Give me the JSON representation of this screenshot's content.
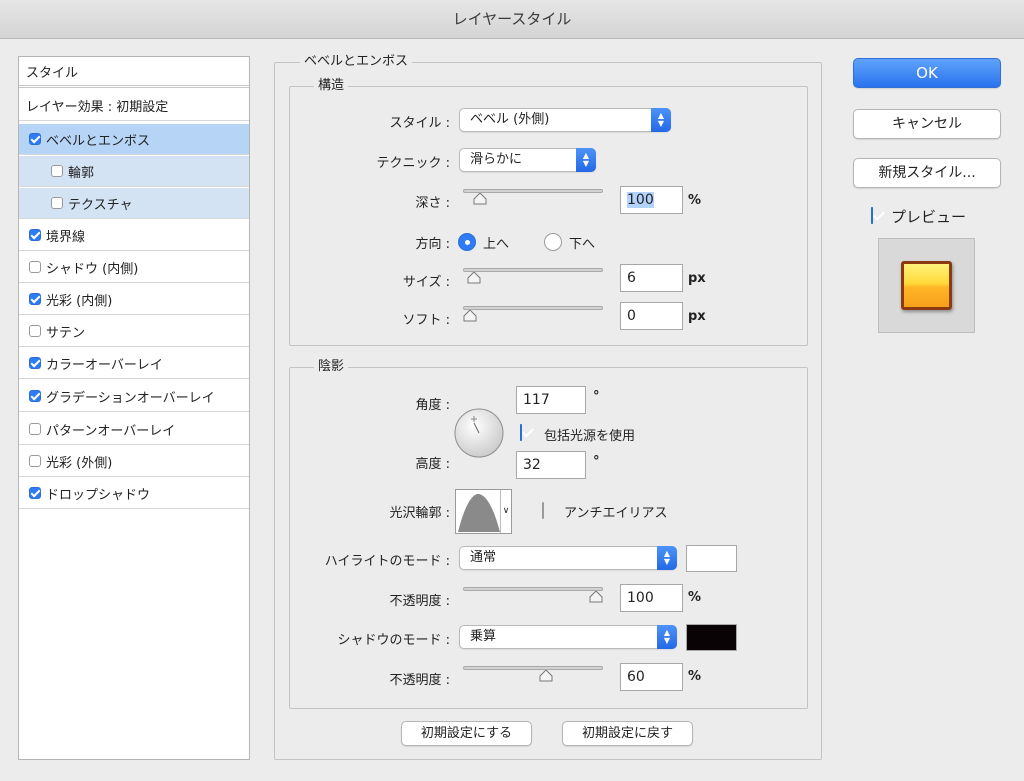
{
  "window": {
    "title": "レイヤースタイル"
  },
  "stylelist": {
    "header": "スタイル",
    "blend_options": "レイヤー効果 : 初期設定",
    "items": [
      {
        "label": "ベベルとエンボス",
        "checked": true
      },
      {
        "label": "輪郭",
        "checked": false
      },
      {
        "label": "テクスチャ",
        "checked": false
      },
      {
        "label": "境界線",
        "checked": true
      },
      {
        "label": "シャドウ (内側)",
        "checked": false
      },
      {
        "label": "光彩 (内側)",
        "checked": true
      },
      {
        "label": "サテン",
        "checked": false
      },
      {
        "label": "カラーオーバーレイ",
        "checked": true
      },
      {
        "label": "グラデーションオーバーレイ",
        "checked": true
      },
      {
        "label": "パターンオーバーレイ",
        "checked": false
      },
      {
        "label": "光彩 (外側)",
        "checked": false
      },
      {
        "label": "ドロップシャドウ",
        "checked": true
      }
    ]
  },
  "bevel": {
    "title": "ベベルとエンボス",
    "structure": {
      "title": "構造",
      "style_label": "スタイル :",
      "style_value": "ベベル (外側)",
      "technique_label": "テクニック :",
      "technique_value": "滑らかに",
      "depth_label": "深さ :",
      "depth_value": "100",
      "depth_unit": "%",
      "depth_level": 0.08,
      "direction_label": "方向 :",
      "direction_up": "上へ",
      "direction_down": "下へ",
      "direction_selected": "up",
      "size_label": "サイズ :",
      "size_value": "6",
      "size_unit": "px",
      "size_level": 0.03,
      "soften_label": "ソフト :",
      "soften_value": "0",
      "soften_unit": "px",
      "soften_level": 0.0
    },
    "shading": {
      "title": "陰影",
      "angle_label": "角度 :",
      "angle_value": "117",
      "angle_unit": "°",
      "global_light_label": "包括光源を使用",
      "global_light_checked": true,
      "altitude_label": "高度 :",
      "altitude_value": "32",
      "altitude_unit": "°",
      "gloss_label": "光沢輪郭 :",
      "antialias_label": "アンチエイリアス",
      "antialias_checked": false,
      "highlight_mode_label": "ハイライトのモード :",
      "highlight_mode_value": "通常",
      "highlight_color": "#ffffff",
      "highlight_opacity_label": "不透明度 :",
      "highlight_opacity_value": "100",
      "highlight_opacity_unit": "%",
      "highlight_opacity_level": 1.0,
      "shadow_mode_label": "シャドウのモード :",
      "shadow_mode_value": "乗算",
      "shadow_color": "#0a0305",
      "shadow_opacity_label": "不透明度 :",
      "shadow_opacity_value": "60",
      "shadow_opacity_unit": "%",
      "shadow_opacity_level": 0.6
    },
    "make_default_label": "初期設定にする",
    "reset_default_label": "初期設定に戻す"
  },
  "actions": {
    "ok_label": "OK",
    "cancel_label": "キャンセル",
    "new_style_label": "新規スタイル...",
    "preview_label": "プレビュー",
    "preview_checked": true
  },
  "colors": {
    "accent": "#2f7bf5",
    "selected_row": "#b6d5f6",
    "sub_row": "#d3e3f3"
  }
}
